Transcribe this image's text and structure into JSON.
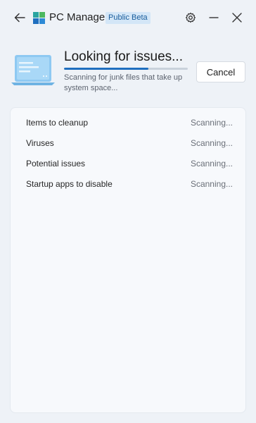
{
  "app": {
    "title": "PC Manager",
    "badge": "Public Beta"
  },
  "icons": {
    "back": "back-arrow-icon",
    "logo": "pc-manager-logo-icon",
    "settings": "gear-icon",
    "minimize": "minimize-icon",
    "close": "close-icon",
    "illustration": "laptop-illustration-icon"
  },
  "scan": {
    "title": "Looking for issues...",
    "subtitle": "Scanning for junk files that take up system space...",
    "progress": 0.68,
    "cancel_label": "Cancel"
  },
  "results": [
    {
      "label": "Items to cleanup",
      "status": "Scanning..."
    },
    {
      "label": "Viruses",
      "status": "Scanning..."
    },
    {
      "label": "Potential issues",
      "status": "Scanning..."
    },
    {
      "label": "Startup apps to disable",
      "status": "Scanning..."
    }
  ],
  "colors": {
    "background": "#eef2f7",
    "accent": "#1f6fbf",
    "badge_bg": "#d3e6f7",
    "badge_text": "#1a5d9c"
  }
}
